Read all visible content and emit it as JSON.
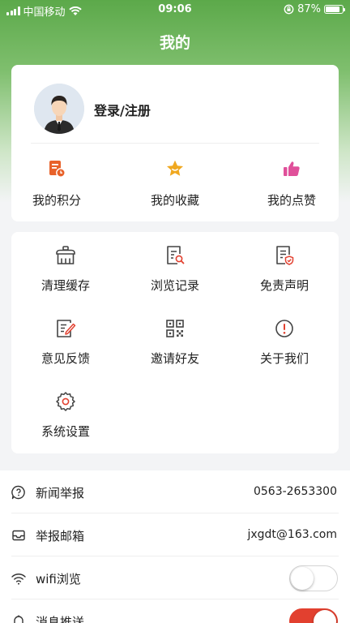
{
  "status_bar": {
    "carrier": "中国移动",
    "time": "09:06",
    "battery": "87%",
    "battery_level": 0.87
  },
  "page_title": "我的",
  "profile": {
    "login_label": "登录/注册"
  },
  "stats": [
    {
      "label": "我的积分",
      "icon": "points-icon",
      "color": "#e8622a"
    },
    {
      "label": "我的收藏",
      "icon": "star-icon",
      "color": "#f0a820"
    },
    {
      "label": "我的点赞",
      "icon": "thumbs-up-icon",
      "color": "#e0509a"
    }
  ],
  "tools": [
    {
      "label": "清理缓存",
      "icon": "clear-cache-icon"
    },
    {
      "label": "浏览记录",
      "icon": "history-icon"
    },
    {
      "label": "免责声明",
      "icon": "disclaimer-icon"
    },
    {
      "label": "意见反馈",
      "icon": "feedback-icon"
    },
    {
      "label": "邀请好友",
      "icon": "qr-code-icon"
    },
    {
      "label": "关于我们",
      "icon": "about-icon"
    },
    {
      "label": "系统设置",
      "icon": "settings-icon"
    }
  ],
  "settings": [
    {
      "label": "新闻举报",
      "value": "0563-2653300",
      "icon": "report-icon"
    },
    {
      "label": "举报邮箱",
      "value": "jxgdt@163.com",
      "icon": "mail-icon"
    },
    {
      "label": "wifi浏览",
      "icon": "wifi-icon",
      "toggle": false
    },
    {
      "label": "消息推送",
      "icon": "bell-icon",
      "toggle": true
    }
  ],
  "colors": {
    "accent": "#5ca94a",
    "toggle_on": "#e2402f",
    "tool_icon": "#444444",
    "tool_icon_accent": "#e2402f"
  }
}
